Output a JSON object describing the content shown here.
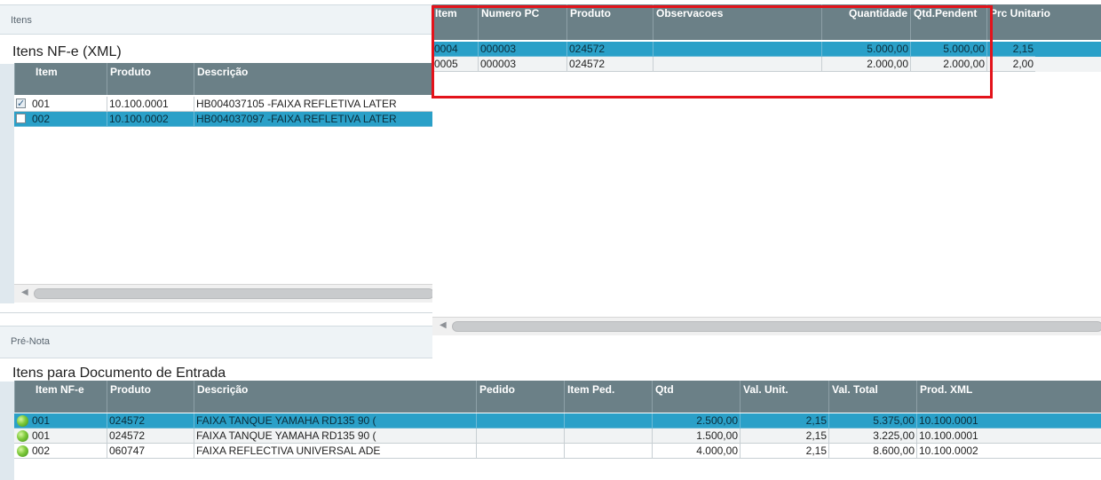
{
  "top_section": {
    "title": "Itens"
  },
  "nfe_panel": {
    "title": "Itens NF-e (XML)",
    "columns": [
      "Item",
      "Produto",
      "Descrição"
    ],
    "rows": [
      {
        "checked": true,
        "item": "001",
        "produto": "10.100.0001",
        "descricao": "HB004037105 -FAIXA REFLETIVA LATER",
        "selected": false
      },
      {
        "checked": false,
        "item": "002",
        "produto": "10.100.0002",
        "descricao": "HB004037097 -FAIXA REFLETIVA LATER",
        "selected": true
      }
    ]
  },
  "pc_panel": {
    "columns": [
      "Item",
      "Numero PC",
      "Produto",
      "Observacoes",
      "Quantidade",
      "Qtd.Pendent",
      "Prc Unitario"
    ],
    "rows": [
      {
        "item": "0004",
        "numero_pc": "000003",
        "produto": "024572",
        "observacoes": "",
        "quantidade": "5.000,00",
        "qtd_pendente": "5.000,00",
        "prc_unitario": "2,15",
        "selected": true
      },
      {
        "item": "0005",
        "numero_pc": "000003",
        "produto": "024572",
        "observacoes": "",
        "quantidade": "2.000,00",
        "qtd_pendente": "2.000,00",
        "prc_unitario": "2,00",
        "selected": false
      }
    ]
  },
  "prenota_section": {
    "title": "Pré-Nota"
  },
  "entrada_panel": {
    "title": "Itens para Documento de Entrada",
    "columns": [
      "Item NF-e",
      "Produto",
      "Descrição",
      "Pedido",
      "Item Ped.",
      "Qtd",
      "Val. Unit.",
      "Val. Total",
      "Prod. XML"
    ],
    "rows": [
      {
        "item_nfe": "001",
        "produto": "024572",
        "descricao": "FAIXA TANQUE YAMAHA RD135 90 (",
        "pedido": "",
        "item_ped": "",
        "qtd": "2.500,00",
        "val_unit": "2,15",
        "val_total": "5.375,00",
        "prod_xml": "10.100.0001",
        "selected": true
      },
      {
        "item_nfe": "001",
        "produto": "024572",
        "descricao": "FAIXA TANQUE YAMAHA RD135 90 (",
        "pedido": "",
        "item_ped": "",
        "qtd": "1.500,00",
        "val_unit": "2,15",
        "val_total": "3.225,00",
        "prod_xml": "10.100.0001",
        "selected": false
      },
      {
        "item_nfe": "002",
        "produto": "060747",
        "descricao": "FAIXA REFLECTIVA UNIVERSAL ADE",
        "pedido": "",
        "item_ped": "",
        "qtd": "4.000,00",
        "val_unit": "2,15",
        "val_total": "8.600,00",
        "prod_xml": "10.100.0002",
        "selected": false
      }
    ]
  },
  "colors": {
    "header": "#6b8087",
    "selected_row": "#2aa0c8",
    "highlight_border": "#e3131b",
    "status_ok": "#7dc93a"
  },
  "icons": {
    "scroll_left": "scroll-left-arrow-icon",
    "status": "green-status-dot-icon",
    "checkbox": "checkbox-icon"
  }
}
